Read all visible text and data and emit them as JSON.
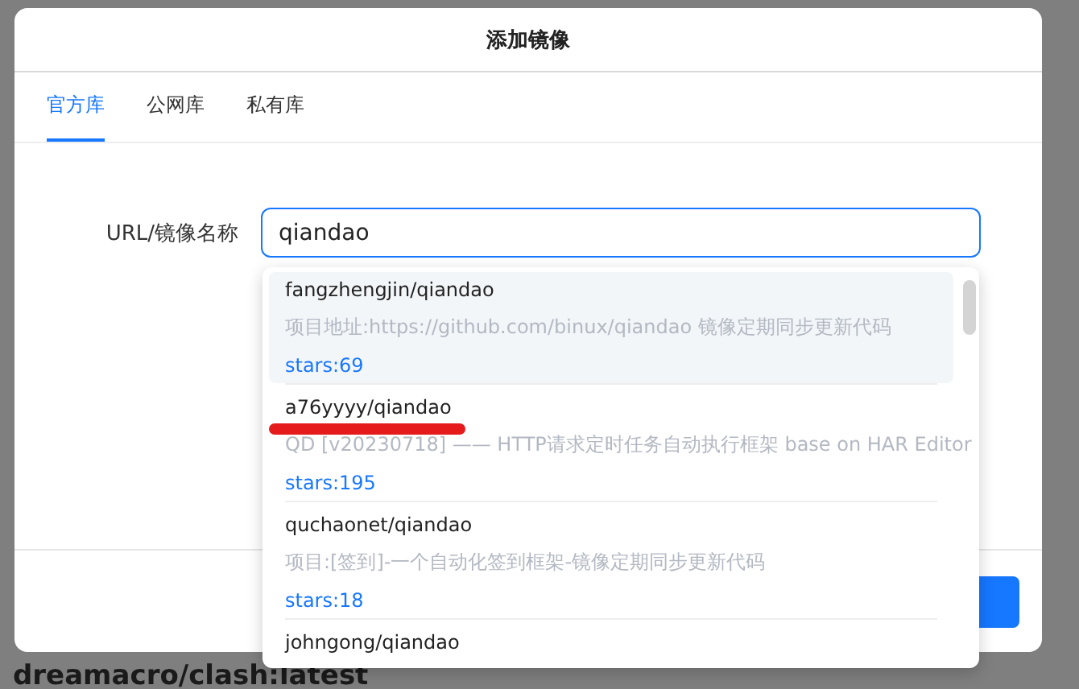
{
  "background": {
    "text": "dreamacro/clash:latest"
  },
  "dialog": {
    "title": "添加镜像",
    "tabs": [
      {
        "label": "官方库",
        "selected": true
      },
      {
        "label": "公网库",
        "selected": false
      },
      {
        "label": "私有库",
        "selected": false
      }
    ],
    "field": {
      "label": "URL/镜像名称",
      "value": "qiandao"
    },
    "suggestions": [
      {
        "name": "fangzhengjin/qiandao",
        "description": "项目地址:https://github.com/binux/qiandao 镜像定期同步更新代码",
        "stars": "stars:69",
        "selected": true,
        "underlined": false
      },
      {
        "name": "a76yyyy/qiandao",
        "description": "QD [v20230718] —— HTTP请求定时任务自动执行框架 base on HAR Editor",
        "stars": "stars:195",
        "selected": false,
        "underlined": true
      },
      {
        "name": "quchaonet/qiandao",
        "description": "项目:[签到]-一个自动化签到框架-镜像定期同步更新代码",
        "stars": "stars:18",
        "selected": false,
        "underlined": false
      },
      {
        "name": "johngong/qiandao",
        "selected": false,
        "underlined": false
      }
    ]
  }
}
